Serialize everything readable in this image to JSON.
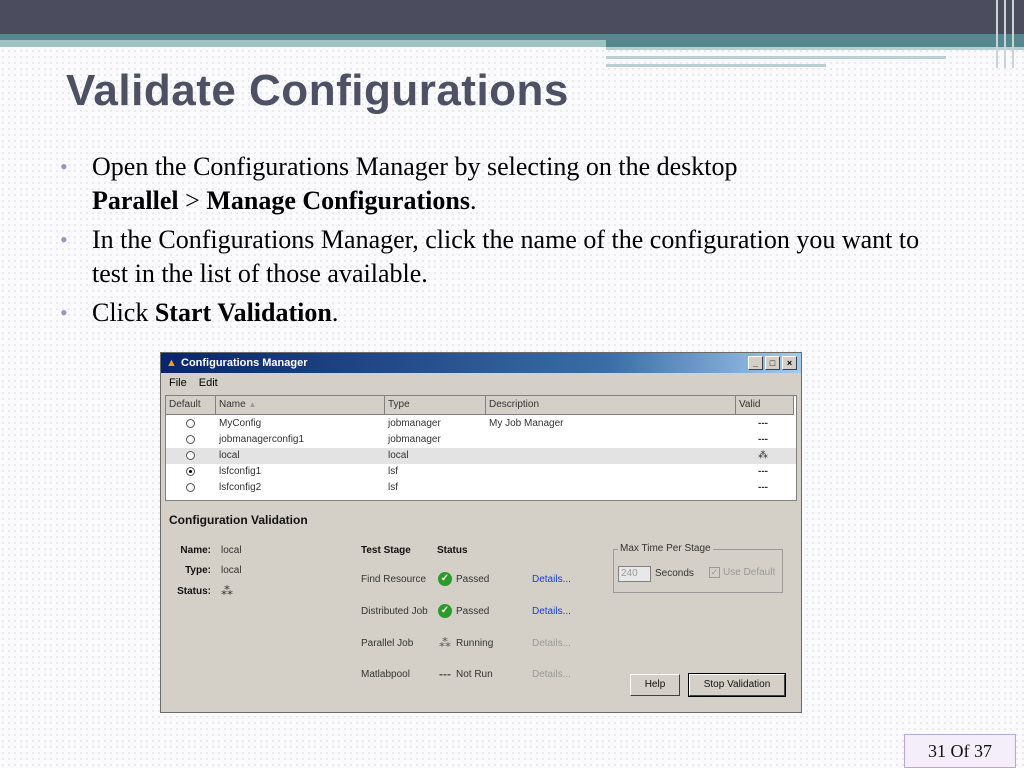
{
  "slide": {
    "title": "Validate Configurations",
    "bullets": [
      {
        "text": "Open the Configurations Manager by selecting on the desktop",
        "bold1": "Parallel",
        "sep": " > ",
        "bold2": "Manage Configurations",
        "end": "."
      },
      {
        "text": "In the Configurations Manager, click the name of the configuration you want to test in the list of those available."
      },
      {
        "pre": "Click ",
        "bold": "Start Validation",
        "end": "."
      }
    ],
    "page_num": "31",
    "page_of": "Of 37"
  },
  "window": {
    "title": "Configurations Manager",
    "menu": [
      "File",
      "Edit"
    ],
    "columns": [
      "Default",
      "Name",
      "Type",
      "Description",
      "Valid"
    ],
    "sort_indicator": "▲",
    "rows": [
      {
        "name": "MyConfig",
        "type": "jobmanager",
        "description": "My Job Manager",
        "valid": "---",
        "default": false,
        "selected": false
      },
      {
        "name": "jobmanagerconfig1",
        "type": "jobmanager",
        "description": "",
        "valid": "---",
        "default": false,
        "selected": false
      },
      {
        "name": "local",
        "type": "local",
        "description": "",
        "valid": "⁂",
        "default": false,
        "selected": true
      },
      {
        "name": "lsfconfig1",
        "type": "lsf",
        "description": "",
        "valid": "---",
        "default": true,
        "selected": false
      },
      {
        "name": "lsfconfig2",
        "type": "lsf",
        "description": "",
        "valid": "---",
        "default": false,
        "selected": false
      }
    ],
    "validation": {
      "heading": "Configuration Validation",
      "name_label": "Name:",
      "name_value": "local",
      "type_label": "Type:",
      "type_value": "local",
      "status_label": "Status:",
      "col_stage": "Test Stage",
      "col_status": "Status",
      "stages": [
        {
          "stage": "Find Resource",
          "status": "Passed",
          "icon": "check-icon",
          "details": "Details...",
          "details_enabled": true
        },
        {
          "stage": "Distributed Job",
          "status": "Passed",
          "icon": "check-icon",
          "details": "Details...",
          "details_enabled": true
        },
        {
          "stage": "Parallel Job",
          "status": "Running",
          "icon": "spinner-icon",
          "details": "Details...",
          "details_enabled": false
        },
        {
          "stage": "Matlabpool",
          "status": "Not Run",
          "icon": "dash-icon",
          "details": "Details...",
          "details_enabled": false
        }
      ],
      "max_time_label": "Max Time Per Stage",
      "max_time_value": "240",
      "seconds_label": "Seconds",
      "use_default_label": "Use Default",
      "help_button": "Help",
      "stop_button": "Stop Validation"
    }
  }
}
